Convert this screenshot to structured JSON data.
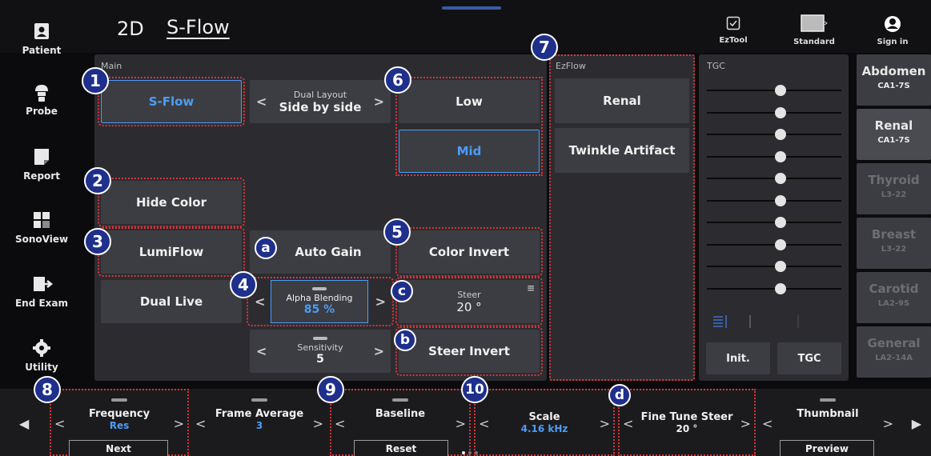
{
  "header": {
    "mode_2d": "2D",
    "mode_active": "S-Flow",
    "tools": [
      {
        "icon": "checkbox-icon",
        "label": "EzTool"
      },
      {
        "icon": "monitor-icon",
        "label": "Standard"
      },
      {
        "icon": "user-icon",
        "label": "Sign in"
      }
    ]
  },
  "sidebar": {
    "items": [
      {
        "icon": "patient-icon",
        "label": "Patient"
      },
      {
        "icon": "probe-icon",
        "label": "Probe"
      },
      {
        "icon": "report-icon",
        "label": "Report"
      },
      {
        "icon": "sonoview-icon",
        "label": "SonoView"
      },
      {
        "icon": "end-exam-icon",
        "label": "End Exam"
      },
      {
        "icon": "gear-icon",
        "label": "Utility"
      }
    ]
  },
  "main": {
    "label": "Main",
    "sflow_button": "S-Flow",
    "dual_layout": {
      "label": "Dual Layout",
      "value": "Side by side"
    },
    "low_button": "Low",
    "mid_button": "Mid",
    "hide_color_button": "Hide Color",
    "lumiflow_button": "LumiFlow",
    "auto_gain_button": "Auto Gain",
    "color_invert_button": "Color Invert",
    "dual_live_button": "Dual Live",
    "alpha_blending": {
      "label": "Alpha Blending",
      "value": "85 %"
    },
    "steer": {
      "label": "Steer",
      "value": "20 °"
    },
    "sensitivity": {
      "label": "Sensitivity",
      "value": "5"
    },
    "steer_invert_button": "Steer Invert"
  },
  "ezflow": {
    "label": "EzFlow",
    "buttons": [
      "Renal",
      "Twinkle Artifact"
    ]
  },
  "tgc": {
    "label": "TGC",
    "levels": [
      0.55,
      0.55,
      0.55,
      0.55,
      0.55,
      0.55,
      0.55,
      0.55,
      0.55,
      0.55
    ],
    "init_button": "Init.",
    "tgc_button": "TGC"
  },
  "presets": [
    {
      "name": "Abdomen",
      "probe": "CA1-7S",
      "state": "normal"
    },
    {
      "name": "Renal",
      "probe": "CA1-7S",
      "state": "active"
    },
    {
      "name": "Thyroid",
      "probe": "L3-22",
      "state": "dim"
    },
    {
      "name": "Breast",
      "probe": "L3-22",
      "state": "dim"
    },
    {
      "name": "Carotid",
      "probe": "LA2-9S",
      "state": "dim"
    },
    {
      "name": "General",
      "probe": "LA2-14A",
      "state": "dim"
    }
  ],
  "bottom": {
    "frequency": {
      "label": "Frequency",
      "value": "Res",
      "sub": "Next"
    },
    "frame_average": {
      "label": "Frame Average",
      "value": "3"
    },
    "baseline": {
      "label": "Baseline",
      "sub": "Reset"
    },
    "scale": {
      "label": "Scale",
      "value": "4.16 kHz"
    },
    "fine_tune_steer": {
      "label": "Fine Tune Steer",
      "value": "20 °"
    },
    "thumbnail": {
      "label": "Thumbnail",
      "sub": "Preview"
    }
  },
  "markers": {
    "m1": "1",
    "m2": "2",
    "m3": "3",
    "m4": "4",
    "m5": "5",
    "m6": "6",
    "m7": "7",
    "m8": "8",
    "m9": "9",
    "m10": "10",
    "ma": "a",
    "mb": "b",
    "mc": "c",
    "md": "d"
  },
  "colors": {
    "accent": "#4b9df7",
    "marker": "#1e2f8c",
    "highlight": "#d8343a"
  }
}
